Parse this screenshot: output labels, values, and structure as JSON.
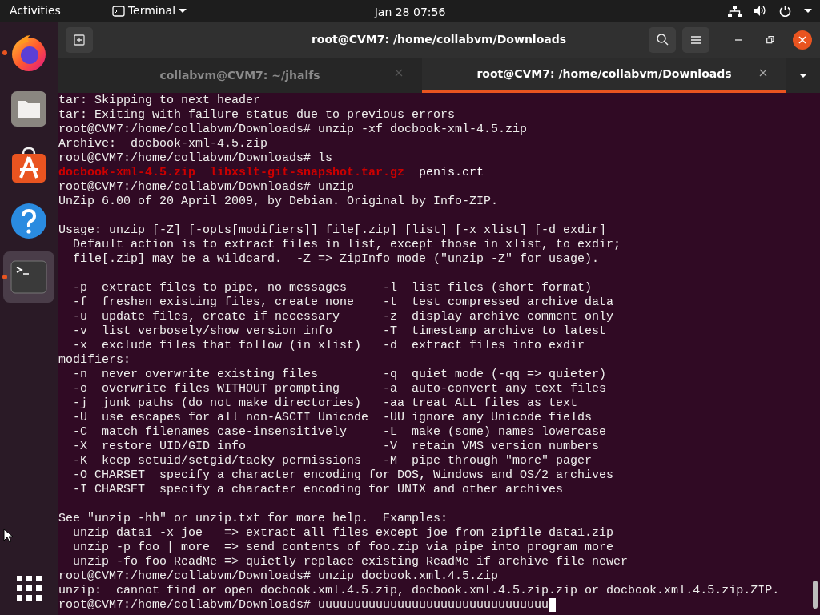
{
  "top_bar": {
    "activities": "Activities",
    "app_menu": "Terminal",
    "clock": "Jan 28  07:56"
  },
  "dock": {
    "apps": [
      {
        "kind": "browser",
        "running": true,
        "selected": false
      },
      {
        "kind": "files",
        "running": false,
        "selected": false
      },
      {
        "kind": "store",
        "running": false,
        "selected": false
      },
      {
        "kind": "help",
        "running": false,
        "selected": false
      },
      {
        "kind": "terminal",
        "running": true,
        "selected": true
      }
    ]
  },
  "window": {
    "title": "root@CVM7: /home/collabvm/Downloads",
    "tabs": [
      {
        "label": "collabvm@CVM7: ~/jhalfs",
        "selected": false
      },
      {
        "label": "root@CVM7: /home/collabvm/Downloads",
        "selected": true
      }
    ]
  },
  "terminal": {
    "lines": [
      {
        "kind": "text",
        "text": "tar: Skipping to next header"
      },
      {
        "kind": "text",
        "text": "tar: Exiting with failure status due to previous errors"
      },
      {
        "kind": "text",
        "text": "root@CVM7:/home/collabvm/Downloads# unzip -xf docbook-xml-4.5.zip"
      },
      {
        "kind": "text",
        "text": "Archive:  docbook-xml-4.5.zip"
      },
      {
        "kind": "text",
        "text": "root@CVM7:/home/collabvm/Downloads# ls"
      },
      {
        "kind": "files",
        "items": [
          {
            "text": "docbook-xml-4.5.zip",
            "color": "#cc0000"
          },
          {
            "text": "libxslt-git-snapshot.tar.gz",
            "color": "#cc0000"
          },
          {
            "text": "penis.crt",
            "color": "#ffffff"
          }
        ]
      },
      {
        "kind": "text",
        "text": "root@CVM7:/home/collabvm/Downloads# unzip"
      },
      {
        "kind": "text",
        "text": "UnZip 6.00 of 20 April 2009, by Debian. Original by Info-ZIP."
      },
      {
        "kind": "blank"
      },
      {
        "kind": "text",
        "text": "Usage: unzip [-Z] [-opts[modifiers]] file[.zip] [list] [-x xlist] [-d exdir]"
      },
      {
        "kind": "text",
        "text": "  Default action is to extract files in list, except those in xlist, to exdir;"
      },
      {
        "kind": "text",
        "text": "  file[.zip] may be a wildcard.  -Z => ZipInfo mode (\"unzip -Z\" for usage)."
      },
      {
        "kind": "blank"
      },
      {
        "kind": "text",
        "text": "  -p  extract files to pipe, no messages     -l  list files (short format)"
      },
      {
        "kind": "text",
        "text": "  -f  freshen existing files, create none    -t  test compressed archive data"
      },
      {
        "kind": "text",
        "text": "  -u  update files, create if necessary      -z  display archive comment only"
      },
      {
        "kind": "text",
        "text": "  -v  list verbosely/show version info       -T  timestamp archive to latest"
      },
      {
        "kind": "text",
        "text": "  -x  exclude files that follow (in xlist)   -d  extract files into exdir"
      },
      {
        "kind": "text",
        "text": "modifiers:"
      },
      {
        "kind": "text",
        "text": "  -n  never overwrite existing files         -q  quiet mode (-qq => quieter)"
      },
      {
        "kind": "text",
        "text": "  -o  overwrite files WITHOUT prompting      -a  auto-convert any text files"
      },
      {
        "kind": "text",
        "text": "  -j  junk paths (do not make directories)   -aa treat ALL files as text"
      },
      {
        "kind": "text",
        "text": "  -U  use escapes for all non-ASCII Unicode  -UU ignore any Unicode fields"
      },
      {
        "kind": "text",
        "text": "  -C  match filenames case-insensitively     -L  make (some) names lowercase"
      },
      {
        "kind": "text",
        "text": "  -X  restore UID/GID info                   -V  retain VMS version numbers"
      },
      {
        "kind": "text",
        "text": "  -K  keep setuid/setgid/tacky permissions   -M  pipe through \"more\" pager"
      },
      {
        "kind": "text",
        "text": "  -O CHARSET  specify a character encoding for DOS, Windows and OS/2 archives"
      },
      {
        "kind": "text",
        "text": "  -I CHARSET  specify a character encoding for UNIX and other archives"
      },
      {
        "kind": "blank"
      },
      {
        "kind": "text",
        "text": "See \"unzip -hh\" or unzip.txt for more help.  Examples:"
      },
      {
        "kind": "text",
        "text": "  unzip data1 -x joe   => extract all files except joe from zipfile data1.zip"
      },
      {
        "kind": "text",
        "text": "  unzip -p foo | more  => send contents of foo.zip via pipe into program more"
      },
      {
        "kind": "text",
        "text": "  unzip -fo foo ReadMe => quietly replace existing ReadMe if archive file newer"
      },
      {
        "kind": "text",
        "text": "root@CVM7:/home/collabvm/Downloads# unzip docbook.xml.4.5.zip"
      },
      {
        "kind": "text",
        "text": "unzip:  cannot find or open docbook.xml.4.5.zip, docbook.xml.4.5.zip.zip or docbook.xml.4.5.zip.ZIP."
      },
      {
        "kind": "input",
        "text": "root@CVM7:/home/collabvm/Downloads# uuuuuuuuuuuuuuuuuuuuuuuuuuuuuuuu"
      }
    ]
  }
}
